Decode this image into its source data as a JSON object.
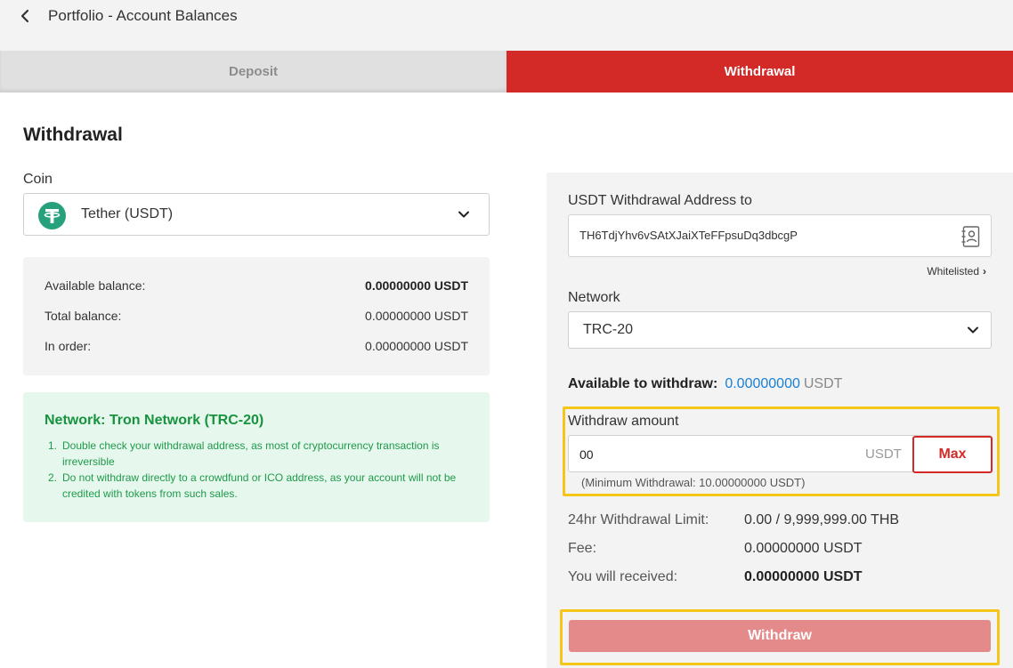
{
  "header": {
    "title": "Portfolio - Account Balances"
  },
  "tabs": [
    {
      "label": "Deposit",
      "active": false
    },
    {
      "label": "Withdrawal",
      "active": true
    }
  ],
  "page": {
    "title": "Withdrawal"
  },
  "coin": {
    "label": "Coin",
    "selected": "Tether (USDT)",
    "icon": "tether-icon"
  },
  "balances": {
    "available_label": "Available balance:",
    "available_value": "0.00000000 USDT",
    "total_label": "Total balance:",
    "total_value": "0.00000000 USDT",
    "in_order_label": "In order:",
    "in_order_value": "0.00000000 USDT"
  },
  "network_note": {
    "title": "Network: Tron Network (TRC-20)",
    "items": [
      {
        "num": "1.",
        "text": "Double check your withdrawal address, as most of cryptocurrency transaction is irreversible"
      },
      {
        "num": "2.",
        "text": "Do not withdraw directly to a crowdfund or ICO address, as your account will not be credited with tokens from such sales."
      }
    ]
  },
  "withdraw_form": {
    "address_label": "USDT Withdrawal Address to",
    "address_value": "TH6TdjYhv6vSAtXJaiXTeFFpsuDq3dbcgP",
    "whitelisted_label": "Whitelisted",
    "network_label": "Network",
    "network_value": "TRC-20",
    "available_label": "Available to withdraw:",
    "available_amount": "0.00000000",
    "available_unit": "USDT",
    "amount_label": "Withdraw amount",
    "amount_value": "00",
    "amount_unit": "USDT",
    "max_label": "Max",
    "min_note": "(Minimum Withdrawal: 10.00000000 USDT)",
    "limit_label": "24hr Withdrawal Limit:",
    "limit_value": "0.00 / 9,999,999.00 THB",
    "fee_label": "Fee:",
    "fee_value": "0.00000000 USDT",
    "receive_label": "You will received:",
    "receive_value": "0.00000000 USDT",
    "submit_label": "Withdraw"
  },
  "colors": {
    "brand_red": "#d42a27",
    "tether_green": "#26a17b",
    "note_green": "#17933e",
    "link_blue": "#1a7fd4",
    "highlight_yellow": "#f5c518",
    "disabled_button": "#e58a8a"
  }
}
